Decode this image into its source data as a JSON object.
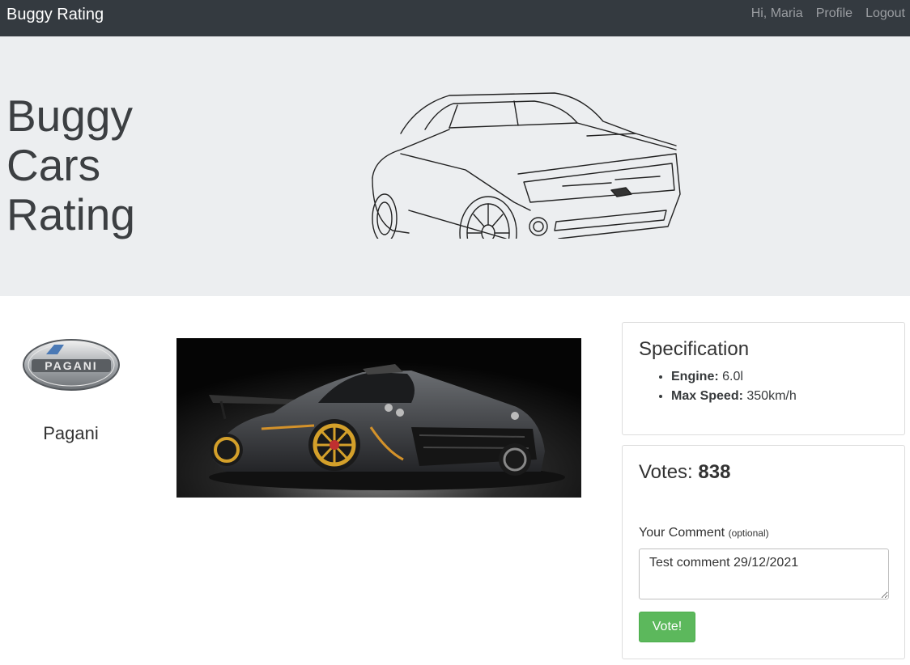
{
  "navbar": {
    "brand": "Buggy Rating",
    "greeting": "Hi, Maria",
    "profile_label": "Profile",
    "logout_label": "Logout"
  },
  "hero": {
    "title_lines": [
      "Buggy",
      "Cars",
      "Rating"
    ]
  },
  "make": {
    "logo_text": "PAGANI",
    "name": "Pagani"
  },
  "specification": {
    "title": "Specification",
    "items": [
      {
        "label": "Engine:",
        "value": "6.0l"
      },
      {
        "label": "Max Speed:",
        "value": "350km/h"
      }
    ]
  },
  "votes": {
    "label": "Votes:",
    "count": "838",
    "comment_label": "Your Comment",
    "comment_hint": "(optional)",
    "comment_value": "Test comment 29/12/2021",
    "vote_button": "Vote!"
  },
  "colors": {
    "navbar": "#343a40",
    "jumbotron": "#eceef0",
    "vote_button": "#5cb85c"
  }
}
